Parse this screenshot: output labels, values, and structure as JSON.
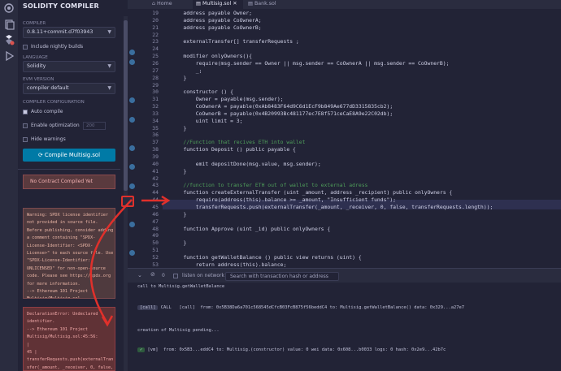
{
  "sidebar_panel": {
    "title": "SOLIDITY COMPILER",
    "compiler_label": "COMPILER",
    "compiler_value": "0.8.11+commit.d7f03943",
    "nightly_label": "Include nightly builds",
    "language_label": "LANGUAGE",
    "language_value": "Solidity",
    "evm_label": "EVM VERSION",
    "evm_value": "compiler default",
    "config_label": "COMPILER CONFIGURATION",
    "auto_compile_label": "Auto compile",
    "optimization_label": "Enable optimization",
    "optimization_runs": "200",
    "hide_warnings_label": "Hide warnings",
    "compile_button": "Compile Multisig.sol",
    "no_contract_text": "No Contract Compiled Yet",
    "warning_text": "Warning: SPDX license identifier\nnot provided in source file.\nBefore publishing, consider adding\na comment containing \"SPDX-\nLicense-Identifier: <SPDX-\nLicense>\" to each source file. Use\n\"SPDX-License-Identifier:\nUNLICENSED\" for non-open-source\ncode. Please see https://spdx.org\nfor more information.\n--> Ethereum 101 Project\nMultisig/Multisig.sol",
    "error_text": "DeclarationError: Undeclared\nidentifier.\n--> Ethereum 101 Project\nMultisig/Multisig.sol:45:56:\n|\n45 |\ntransferRequests.push(externalTran\nsfer(_amount, _receiver, 0, false,"
  },
  "tabs": [
    {
      "label": "Home"
    },
    {
      "label": "Multisig.sol"
    },
    {
      "label": "Bank.sol"
    }
  ],
  "code_lines": [
    {
      "n": "19",
      "text": "    address payable Owner;"
    },
    {
      "n": "20",
      "text": "    address payable CoOwnerA;"
    },
    {
      "n": "21",
      "text": "    address payable CoOwnerB;"
    },
    {
      "n": "22",
      "text": ""
    },
    {
      "n": "23",
      "text": "    externalTransfer[] transferRequests ;"
    },
    {
      "n": "24",
      "text": ""
    },
    {
      "n": "25",
      "text": "    modifier onlyOwners(){"
    },
    {
      "n": "26",
      "text": "        require(msg.sender == Owner || msg.sender == CoOwnerA || msg.sender == CoOwnerB);"
    },
    {
      "n": "27",
      "text": "        _;"
    },
    {
      "n": "28",
      "text": "    }"
    },
    {
      "n": "29",
      "text": ""
    },
    {
      "n": "30",
      "text": "    constructor () {"
    },
    {
      "n": "31",
      "text": "        Owner = payable(msg.sender);"
    },
    {
      "n": "32",
      "text": "        CoOwnerA = payable(0xAb8483F64d9C6d1EcF9b849Ae677dD3315835cb2);"
    },
    {
      "n": "33",
      "text": "        CoOwnerB = payable(0x4B20993Bc481177ec7E8f571ceCaE8A9e22C02db);"
    },
    {
      "n": "34",
      "text": "        uint limit = 3;"
    },
    {
      "n": "35",
      "text": "    }"
    },
    {
      "n": "36",
      "text": ""
    },
    {
      "n": "37",
      "text": "    //Function that recives ETH into wallet"
    },
    {
      "n": "38",
      "text": "    function Deposit () public payable {"
    },
    {
      "n": "39",
      "text": ""
    },
    {
      "n": "40",
      "text": "        emit depositDone(msg.value, msg.sender);"
    },
    {
      "n": "41",
      "text": "    }"
    },
    {
      "n": "42",
      "text": ""
    },
    {
      "n": "43",
      "text": "    //function to transfer ETH out of wallet to external adress"
    },
    {
      "n": "44",
      "text": "    function createExternalTransfer (uint _amount, address _recipient) public onlyOwners {"
    },
    {
      "n": "44",
      "text": "        require(address(this).balance >= _amount, \"Insufficient funds\");"
    },
    {
      "n": "45",
      "text": "        transferRequests.push(externalTransfer(_amount, _receiver, 0, false, transferRequests.length));"
    },
    {
      "n": "46",
      "text": "    }"
    },
    {
      "n": "47",
      "text": ""
    },
    {
      "n": "48",
      "text": "    function Approve (uint _id) public onlyOwners {"
    },
    {
      "n": "49",
      "text": ""
    },
    {
      "n": "50",
      "text": "    }"
    },
    {
      "n": "51",
      "text": ""
    },
    {
      "n": "52",
      "text": "    function getWalletBalance () public view returns (uint) {"
    },
    {
      "n": "53",
      "text": "        return address(this).balance;"
    }
  ],
  "terminal": {
    "counter": "0",
    "listen_label": "listen on network",
    "search_placeholder": "Search with transaction hash or address",
    "lines": [
      "call to Multisig.getWalletBalance",
      "",
      "CALL   [call]  from: 0x5B38Da6a701c568545dCfcB03FcB875f56beddC4 to: Multisig.getWalletBalance() data: 0x329...a27e7",
      "",
      "creation of Multisig pending...",
      "",
      "[vm]  from: 0x5B3...eddC4 to: Multisig.(constructor) value: 0 wei data: 0x608...b0033 logs: 0 hash: 0x2e9...42b7c"
    ]
  },
  "colors": {
    "accent": "#007aa6",
    "error": "#e0302b",
    "background": "#222336"
  }
}
